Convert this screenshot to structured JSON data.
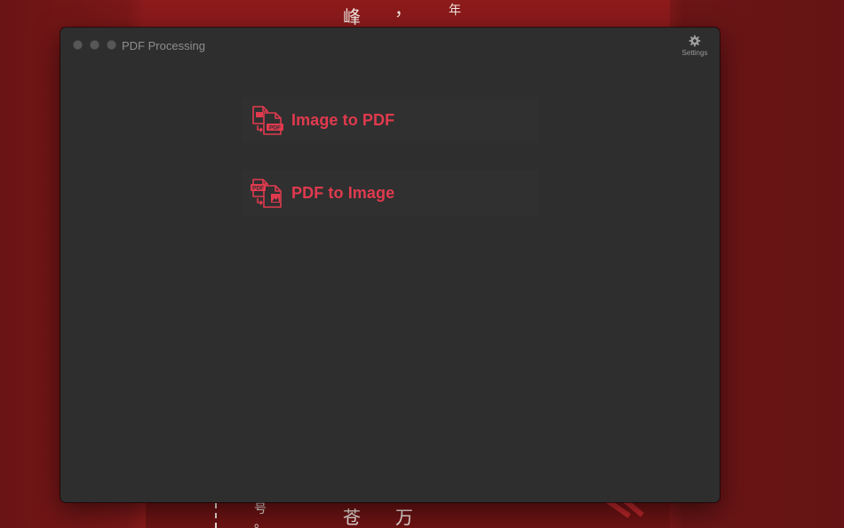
{
  "window": {
    "title": "PDF Processing"
  },
  "toolbar": {
    "settings_label": "Settings",
    "settings_icon": "gear-icon"
  },
  "actions": [
    {
      "label": "Image to PDF",
      "icon": "image-to-pdf-icon",
      "badge": "PDF"
    },
    {
      "label": "PDF to Image",
      "icon": "pdf-to-image-icon",
      "badge": "PDF"
    }
  ],
  "wallpaper": {
    "chars": [
      "峰",
      "，",
      "年",
      "号",
      "。",
      "苍",
      "万"
    ]
  },
  "colors": {
    "accent": "#e03a4e",
    "window_bg": "#2e2e2e",
    "desktop": "#8a1a1b"
  }
}
